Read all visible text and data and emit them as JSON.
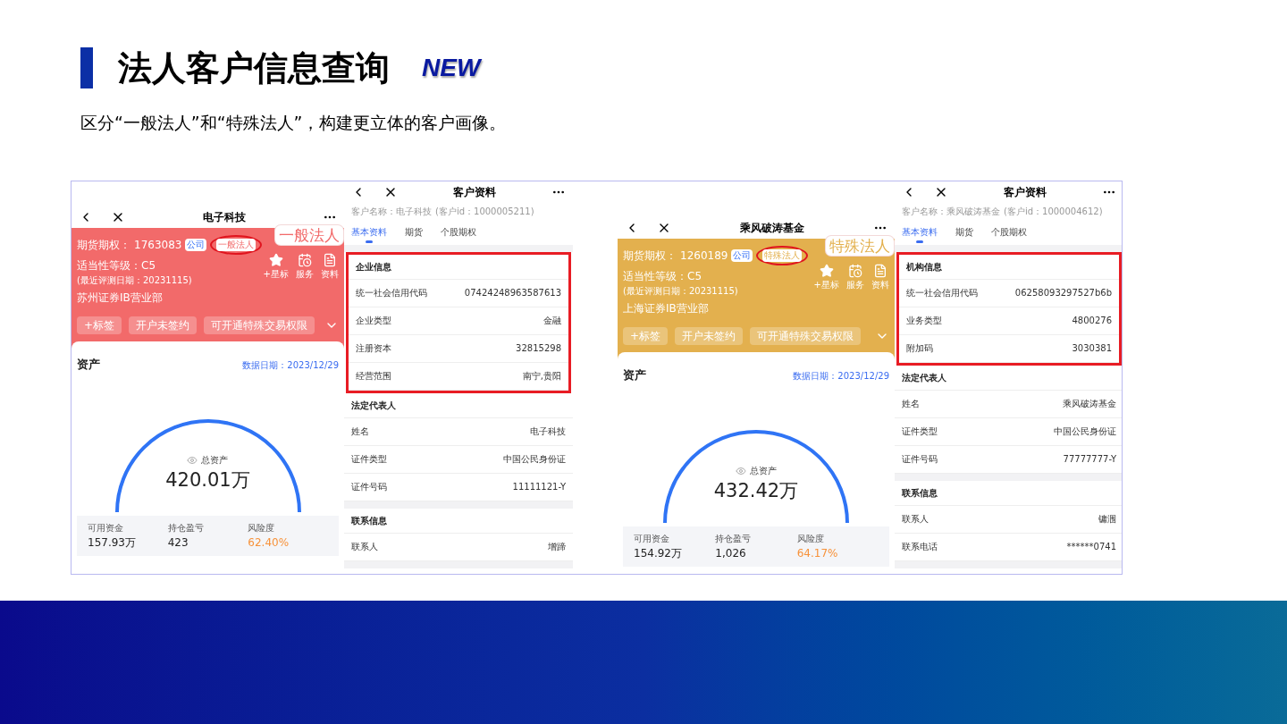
{
  "title": "法人客户信息查询",
  "badge": "NEW",
  "subtitle": "区分“一般法人”和“特殊法人”，构建更立体的客户画像。",
  "screens": [
    {
      "kind": "overview",
      "color": "#f26a6a",
      "nav_title": "电子科技",
      "callout": "一般法人",
      "account_label": "期货期权：",
      "account": "1763083",
      "tags": [
        "公司",
        "一般法人"
      ],
      "suitability": "适当性等级：C5",
      "eval_date": "(最近评测日期：20231115)",
      "branch": "苏州证券IB营业部",
      "actions": [
        "+星标",
        "服务",
        "资料"
      ],
      "chips": [
        "+标签",
        "开户未签约",
        "可开通特殊交易权限"
      ],
      "asset_title": "资产",
      "data_date": "数据日期：2023/12/29",
      "total_label": "总资产",
      "total": "420.01万",
      "stats": [
        {
          "label": "可用资金",
          "value": "157.93万",
          "color": "#222222"
        },
        {
          "label": "持仓盈亏",
          "value": "423",
          "color": "#222222"
        },
        {
          "label": "风险度",
          "value": "62.40%",
          "color": "#f7923a"
        }
      ]
    },
    {
      "kind": "profile",
      "nav_title": "客户资料",
      "customer": "客户名称：电子科技",
      "customer_id": "(客户id：1000005211)",
      "tabs": [
        {
          "label": "基本资料",
          "selected": true
        },
        {
          "label": "期货",
          "selected": false
        },
        {
          "label": "个股期权",
          "selected": false
        }
      ],
      "sections": [
        {
          "title": "企业信息",
          "highlighted": true,
          "rows": [
            {
              "label": "统一社会信用代码",
              "value": "07424248963587613"
            },
            {
              "label": "企业类型",
              "value": "金融"
            },
            {
              "label": "注册资本",
              "value": "32815298"
            },
            {
              "label": "经营范围",
              "value": "南宁,贵阳"
            }
          ]
        },
        {
          "title": "法定代表人",
          "highlighted": false,
          "rows": [
            {
              "label": "姓名",
              "value": "电子科技"
            },
            {
              "label": "证件类型",
              "value": "中国公民身份证"
            },
            {
              "label": "证件号码",
              "value": "11111121-Y"
            }
          ]
        },
        {
          "title": "联系信息",
          "highlighted": false,
          "rows": [
            {
              "label": "联系人",
              "value": "增蹄"
            }
          ]
        }
      ]
    },
    {
      "kind": "overview",
      "color": "#e3b04e",
      "nav_title": "乘风破涛基金",
      "callout": "特殊法人",
      "account_label": "期货期权：",
      "account": "1260189",
      "tags": [
        "公司",
        "特殊法人"
      ],
      "suitability": "适当性等级：C5",
      "eval_date": "(最近评测日期：20231115)",
      "branch": "上海证券IB营业部",
      "actions": [
        "+星标",
        "服务",
        "资料"
      ],
      "chips": [
        "+标签",
        "开户未签约",
        "可开通特殊交易权限"
      ],
      "asset_title": "资产",
      "data_date": "数据日期：2023/12/29",
      "total_label": "总资产",
      "total": "432.42万",
      "stats": [
        {
          "label": "可用资金",
          "value": "154.92万",
          "color": "#222222"
        },
        {
          "label": "持仓盈亏",
          "value": "1,026",
          "color": "#222222"
        },
        {
          "label": "风险度",
          "value": "64.17%",
          "color": "#f7923a"
        }
      ]
    },
    {
      "kind": "profile",
      "nav_title": "客户资料",
      "customer": "客户名称：乘风破涛基金",
      "customer_id": "(客户id：1000004612)",
      "tabs": [
        {
          "label": "基本资料",
          "selected": true
        },
        {
          "label": "期货",
          "selected": false
        },
        {
          "label": "个股期权",
          "selected": false
        }
      ],
      "sections": [
        {
          "title": "机构信息",
          "highlighted": true,
          "rows": [
            {
              "label": "统一社会信用代码",
              "value": "06258093297527b6b"
            },
            {
              "label": "业务类型",
              "value": "4800276"
            },
            {
              "label": "附加码",
              "value": "3030381"
            }
          ]
        },
        {
          "title": "法定代表人",
          "highlighted": false,
          "rows": [
            {
              "label": "姓名",
              "value": "乘风破涛基金"
            },
            {
              "label": "证件类型",
              "value": "中国公民身份证"
            },
            {
              "label": "证件号码",
              "value": "77777777-Y"
            }
          ]
        },
        {
          "title": "联系信息",
          "highlighted": false,
          "rows": [
            {
              "label": "联系人",
              "value": "镛涠"
            },
            {
              "label": "联系电话",
              "value": "******0741"
            }
          ]
        }
      ]
    }
  ]
}
